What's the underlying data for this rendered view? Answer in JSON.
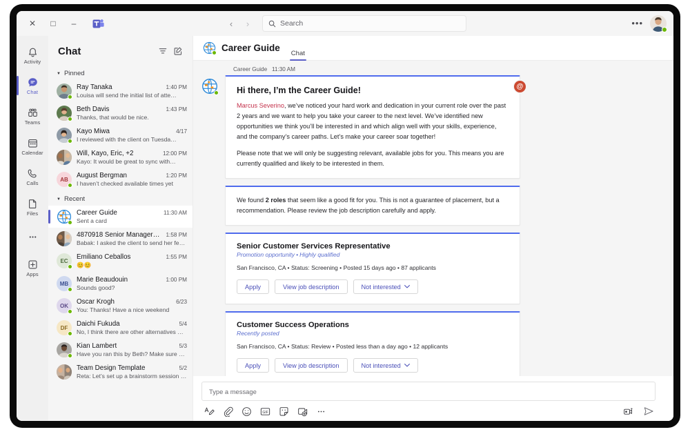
{
  "titlebar": {
    "close_label": "✕",
    "maximize_label": "□",
    "minimize_label": "–",
    "app_icon": "teams-logo-icon",
    "back_label": "‹",
    "forward_label": "›",
    "search_placeholder": "Search",
    "more_label": "•••"
  },
  "rail": {
    "items": [
      {
        "label": "Activity",
        "icon": "bell-icon",
        "active": false
      },
      {
        "label": "Chat",
        "icon": "chat-bubble-icon",
        "active": true
      },
      {
        "label": "Teams",
        "icon": "teams-people-icon",
        "active": false
      },
      {
        "label": "Calendar",
        "icon": "calendar-icon",
        "active": false
      },
      {
        "label": "Calls",
        "icon": "phone-icon",
        "active": false
      },
      {
        "label": "Files",
        "icon": "file-icon",
        "active": false
      },
      {
        "label": "",
        "icon": "more-dots-icon",
        "active": false
      },
      {
        "label": "Apps",
        "icon": "apps-plus-icon",
        "active": false
      }
    ]
  },
  "chatlist": {
    "title": "Chat",
    "filter_icon": "filter-icon",
    "compose_icon": "new-chat-icon",
    "groups": [
      {
        "label": "Pinned",
        "items": [
          {
            "name": "Ray Tanaka",
            "time": "1:40 PM",
            "preview": "Louisa will send the initial list of atte…",
            "initials": "",
            "avatar_type": "photo",
            "avatar_color": "#8a7f6e",
            "selected": false
          },
          {
            "name": "Beth Davis",
            "time": "1:43 PM",
            "preview": "Thanks, that would be nice.",
            "initials": "",
            "avatar_type": "photo",
            "avatar_color": "#4b6b4a",
            "selected": false
          },
          {
            "name": "Kayo Miwa",
            "time": "4/17",
            "preview": "I reviewed with the client on Tuesda…",
            "initials": "",
            "avatar_type": "photo",
            "avatar_color": "#6b7a8c",
            "selected": false
          },
          {
            "name": "Will, Kayo, Eric, +2",
            "time": "12:00 PM",
            "preview": "Kayo: It would be great to sync with…",
            "initials": "",
            "avatar_type": "group",
            "avatar_color": "#7d6a52",
            "selected": false
          },
          {
            "name": "August Bergman",
            "time": "1:20 PM",
            "preview": "I haven’t checked available times yet",
            "initials": "AB",
            "avatar_type": "initials",
            "avatar_color": "#f7d6db",
            "initials_color": "#a4373a",
            "selected": false
          }
        ]
      },
      {
        "label": "Recent",
        "items": [
          {
            "name": "Career Guide",
            "time": "11:30 AM",
            "preview": "Sent a card",
            "initials": "",
            "avatar_type": "globe",
            "avatar_color": "#2e8ad8",
            "selected": true
          },
          {
            "name": "4870918 Senior Manager…",
            "time": "1:58 PM",
            "preview": "Babak: I asked the client to send her feed…",
            "initials": "",
            "avatar_type": "group",
            "avatar_color": "#6f5b4a",
            "selected": false
          },
          {
            "name": "Emiliano Ceballos",
            "time": "1:55 PM",
            "preview": "😊😊",
            "initials": "EC",
            "avatar_type": "initials",
            "avatar_color": "#dfe8d8",
            "initials_color": "#4c6b3c",
            "selected": false
          },
          {
            "name": "Marie Beaudouin",
            "time": "1:00 PM",
            "preview": "Sounds good?",
            "initials": "MB",
            "avatar_type": "initials",
            "avatar_color": "#cfd9f0",
            "initials_color": "#3b4f90",
            "selected": false
          },
          {
            "name": "Oscar Krogh",
            "time": "6/23",
            "preview": "You: Thanks! Have a nice weekend",
            "initials": "OK",
            "avatar_type": "initials",
            "avatar_color": "#ded7ec",
            "initials_color": "#5b4a87",
            "selected": false
          },
          {
            "name": "Daichi Fukuda",
            "time": "5/4",
            "preview": "No, I think there are other alternatives we c…",
            "initials": "DF",
            "avatar_type": "initials",
            "avatar_color": "#f6e7c4",
            "initials_color": "#8a6a22",
            "selected": false
          },
          {
            "name": "Kian Lambert",
            "time": "5/3",
            "preview": "Have you ran this by Beth? Make sure she is…",
            "initials": "",
            "avatar_type": "photo",
            "avatar_color": "#5d5a57",
            "selected": false
          },
          {
            "name": "Team Design Template",
            "time": "5/2",
            "preview": "Reta: Let’s set up a brainstorm session for…",
            "initials": "",
            "avatar_type": "group",
            "avatar_color": "#8e7b6c",
            "selected": false
          }
        ]
      }
    ]
  },
  "main": {
    "title": "Career Guide",
    "avatar_icon": "globe-icon",
    "tabs": [
      {
        "label": "Chat",
        "active": true
      }
    ],
    "message": {
      "sender": "Career Guide",
      "timestamp": "11:30 AM",
      "mention_badge": "@"
    },
    "cards": {
      "greeting": {
        "title": "Hi there, I’m the Career Guide!",
        "mention": "Marcus Severino",
        "paragraph1_rest": ", we’ve noticed your hard work and dedication in your current role over the past 2 years and we want to help you take your career to the next level. We’ve identified new opportunities we think you’ll be interested in and which align well with your skills, experience, and the company’s career paths. Let’s make your career soar together!",
        "paragraph2": "Please note that we will only be suggesting relevant, available jobs for you. This means you are currently qualified and likely to be interested in them."
      },
      "summary": {
        "prefix": "We found ",
        "highlight": "2 roles",
        "suffix": " that seem like a good fit for you. This is not a guarantee of placement, but a recommendation. Please review the job description carefully and apply."
      },
      "jobs": [
        {
          "title": "Senior Customer Services Representative",
          "tag1": "Promotion opportunity",
          "tag_sep": "•",
          "tag2": "Highly qualified",
          "details": "San Francisco, CA • Status: Screening • Posted 15 days ago • 87 applicants",
          "apply_label": "Apply",
          "view_label": "View job description",
          "not_interested_label": "Not interested",
          "chevron": "⌄"
        },
        {
          "title": "Customer Success Operations",
          "tag1": "Recently posted",
          "tag_sep": "",
          "tag2": "",
          "details": "San Francisco, CA • Status: Review • Posted less than a day ago • 12 applicants",
          "apply_label": "Apply",
          "view_label": "View job description",
          "not_interested_label": "Not interested",
          "chevron": "⌄"
        }
      ]
    },
    "compose": {
      "placeholder": "Type a message",
      "tools": [
        {
          "icon": "format-text-icon"
        },
        {
          "icon": "attach-paperclip-icon"
        },
        {
          "icon": "emoji-icon"
        },
        {
          "icon": "gif-icon"
        },
        {
          "icon": "sticker-icon"
        },
        {
          "icon": "meet-now-icon"
        },
        {
          "icon": "more-options-icon"
        }
      ],
      "right_tools": [
        {
          "icon": "video-message-icon"
        },
        {
          "icon": "send-icon"
        }
      ]
    }
  },
  "colors": {
    "accent": "#5b5fc7",
    "card_accent": "#4f6bed",
    "mention_red": "#c4314b",
    "badge_red": "#cc4a31",
    "presence_green": "#6bb700"
  }
}
